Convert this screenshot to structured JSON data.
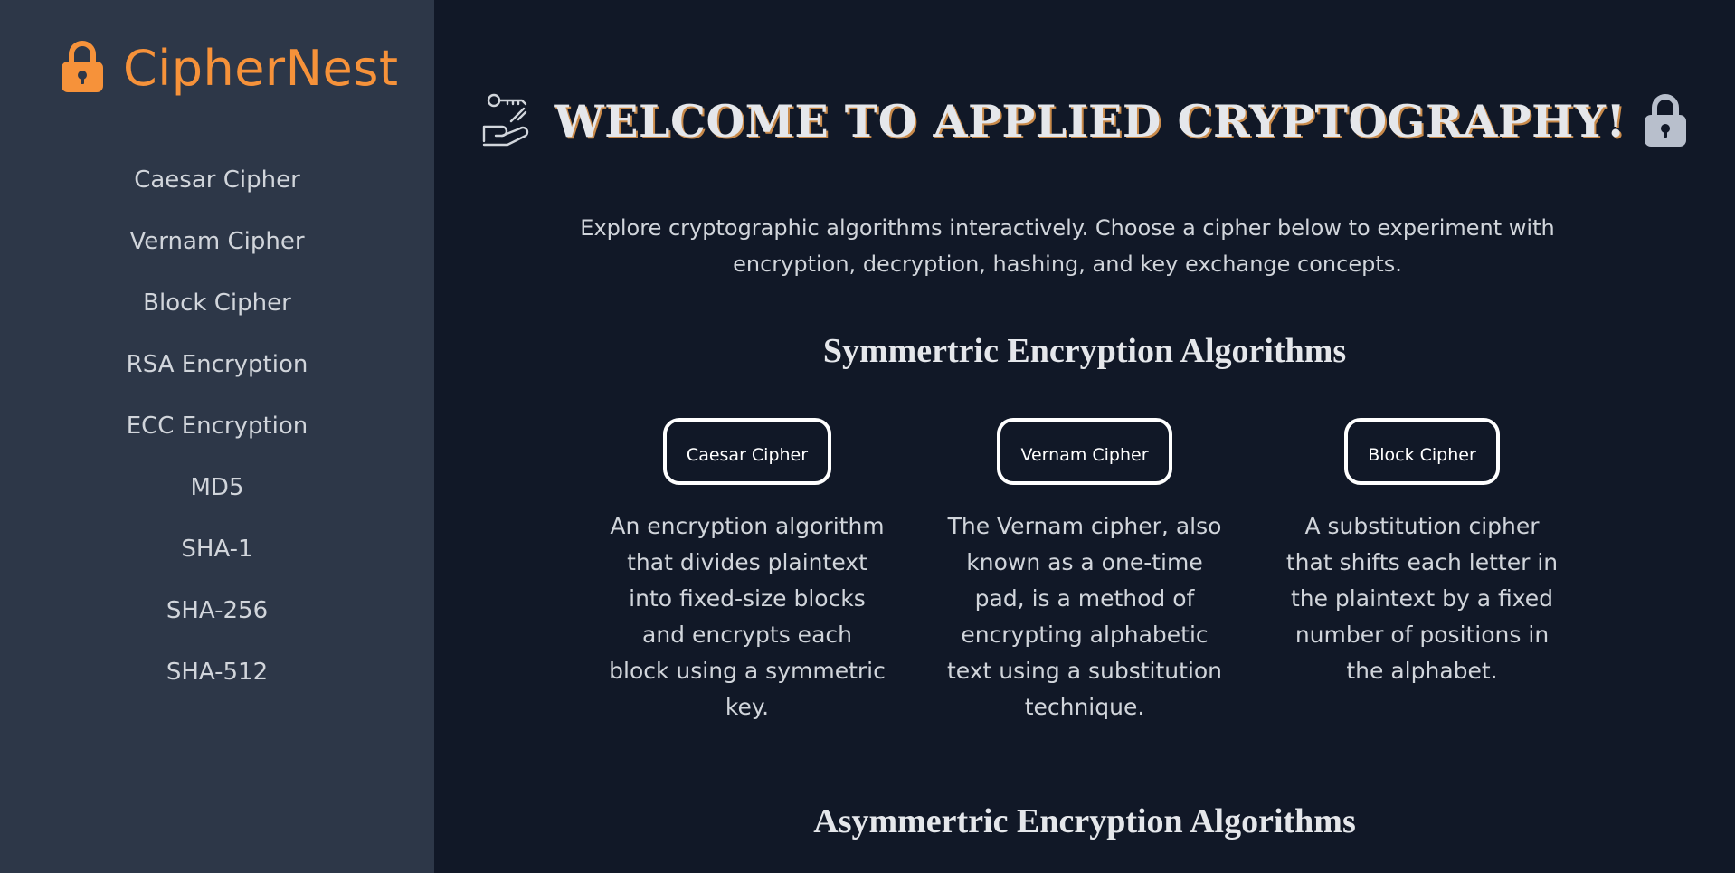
{
  "brand": {
    "name": "CipherNest",
    "icon": "lock-icon",
    "color": "#f6923a"
  },
  "sidebar": {
    "items": [
      {
        "label": "Caesar Cipher"
      },
      {
        "label": "Vernam Cipher"
      },
      {
        "label": "Block Cipher"
      },
      {
        "label": "RSA Encryption"
      },
      {
        "label": "ECC Encryption"
      },
      {
        "label": "MD5"
      },
      {
        "label": "SHA-1"
      },
      {
        "label": "SHA-256"
      },
      {
        "label": "SHA-512"
      }
    ]
  },
  "main": {
    "title": "WELCOME TO APPLIED CRYPTOGRAPHY!",
    "title_icons": [
      "hand-key-icon",
      "padlock-icon"
    ],
    "intro": "Explore cryptographic algorithms interactively. Choose a cipher below to experiment with encryption, decryption, hashing, and key exchange concepts.",
    "sections": [
      {
        "title": "Symmertric Encryption Algorithms",
        "cards": [
          {
            "button": "Caesar Cipher",
            "description": "An encryption algorithm that divides plaintext into fixed-size blocks and encrypts each block using a symmetric key."
          },
          {
            "button": "Vernam Cipher",
            "description": "The Vernam cipher, also known as a one-time pad, is a method of encrypting alphabetic text using a substitution technique."
          },
          {
            "button": "Block Cipher",
            "description": "A substitution cipher that shifts each letter in the plaintext by a fixed number of positions in the alphabet."
          }
        ]
      },
      {
        "title": "Asymmertric Encryption Algorithms"
      }
    ]
  }
}
